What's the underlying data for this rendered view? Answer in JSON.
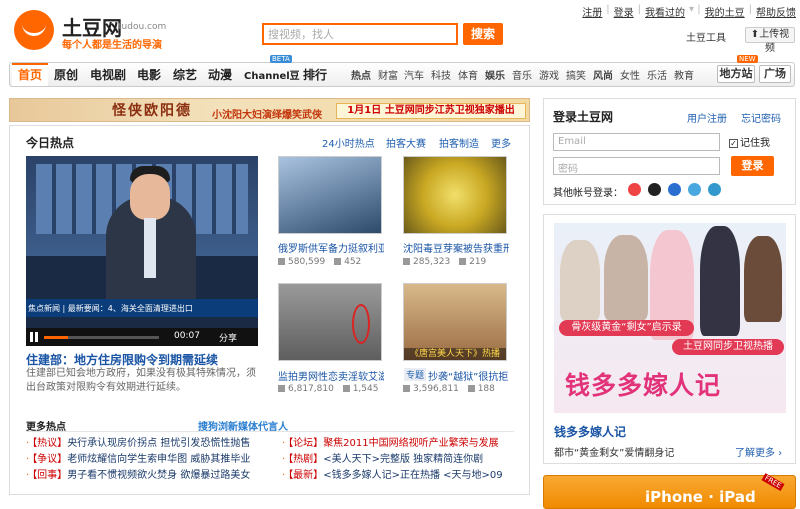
{
  "header": {
    "logo_name": "土豆网",
    "logo_domain": "tudou.com",
    "slogan": "每个人都是生活的导演",
    "search_placeholder": "搜视频，找人",
    "search_button": "搜索",
    "top_links": [
      "注册",
      "登录",
      "我看过的",
      "我的土豆",
      "帮助反馈"
    ],
    "tool_link": "土豆工具",
    "upload_button": "上传视频"
  },
  "nav": {
    "home": "首页",
    "main": [
      "原创",
      "电视剧",
      "电影",
      "综艺",
      "动漫",
      "Channel豆",
      "排行"
    ],
    "beta": "BETA",
    "sub": [
      "热点",
      "财富",
      "汽车",
      "科技",
      "体育",
      "娱乐",
      "音乐",
      "游戏",
      "搞笑",
      "风尚",
      "女性",
      "乐活",
      "教育"
    ],
    "local": "地方站",
    "plaza": "广场",
    "new_tag": "NEW"
  },
  "banner": {
    "title": "怪侠欧阳德",
    "subtitle": "小沈阳大妇演绎爆笑武侠",
    "date_text": "1月1日 土豆网同步江苏卫视独家播出"
  },
  "hot": {
    "title": "今日热点",
    "tabs": [
      "24小时热点",
      "拍客大赛",
      "拍客制造",
      "更多"
    ],
    "video": {
      "ticker": "焦点新闻 | 最新要闻：4、海关全面清理进出口",
      "time": "00:07",
      "share": "分享",
      "title": "住建部：地方住房限购令到期需延续",
      "desc": "住建部已知会地方政府，如果没有极其特殊情况，须出台政策对限购令有效期进行延续。"
    },
    "thumbs": [
      {
        "title": "俄罗斯供军备力挺叙利亚",
        "views": "580,599",
        "comments": "452"
      },
      {
        "title": "沈阳毒豆芽案被告获重刑",
        "views": "285,323",
        "comments": "219"
      },
      {
        "title": "监拍男网性恋卖淫软艾滋",
        "views": "6,817,810",
        "comments": "1,545"
      },
      {
        "title": "抄袭“越狱”很抗拒",
        "views": "3,596,811",
        "comments": "188",
        "tag": "专题"
      }
    ],
    "thumb4_caption": "《唐宫美人天下》热播"
  },
  "more_hot": {
    "title": "更多热点",
    "ad": "搜狗浏新媒体代言人",
    "left": [
      {
        "tag": "【热议】",
        "text": "央行承认现房价拐点 担忧引发恐慌性抛售"
      },
      {
        "tag": "【争议】",
        "text": "老师炫耀信向学生索申华图 威胁其推毕业"
      },
      {
        "tag": "【回事】",
        "text": "男子看不惯视频欲火焚身 欲爆暴过路美女"
      }
    ],
    "right": [
      {
        "tag": "【论坛】",
        "text": "聚焦2011中国网络视听产业繁荣与发展"
      },
      {
        "tag": "【热剧】",
        "text": "<美人天下>完整版    独家精简连你剧"
      },
      {
        "tag": "【最新】",
        "text": "<钱多多嫁人记>正在热播   <天与地>09"
      }
    ]
  },
  "login": {
    "title": "登录土豆网",
    "register": "用户注册",
    "forgot": "忘记密码",
    "email_placeholder": "Email",
    "password_placeholder": "密码",
    "remember": "记住我",
    "button": "登录",
    "other": "其他帐号登录："
  },
  "right_ad": {
    "red_tag": "骨灰级黄金“剩女”启示录",
    "tv_tag": "土豆网同步卫视热播",
    "big_title": "钱多多嫁人记",
    "title": "钱多多嫁人记",
    "desc": "都市“黄金剩女”爱情翻身记",
    "more": "了解更多",
    "iphone": "iPhone · iPad",
    "free": "FREE"
  },
  "colors": {
    "accent": "#ff6600",
    "link": "#1a55a5"
  }
}
